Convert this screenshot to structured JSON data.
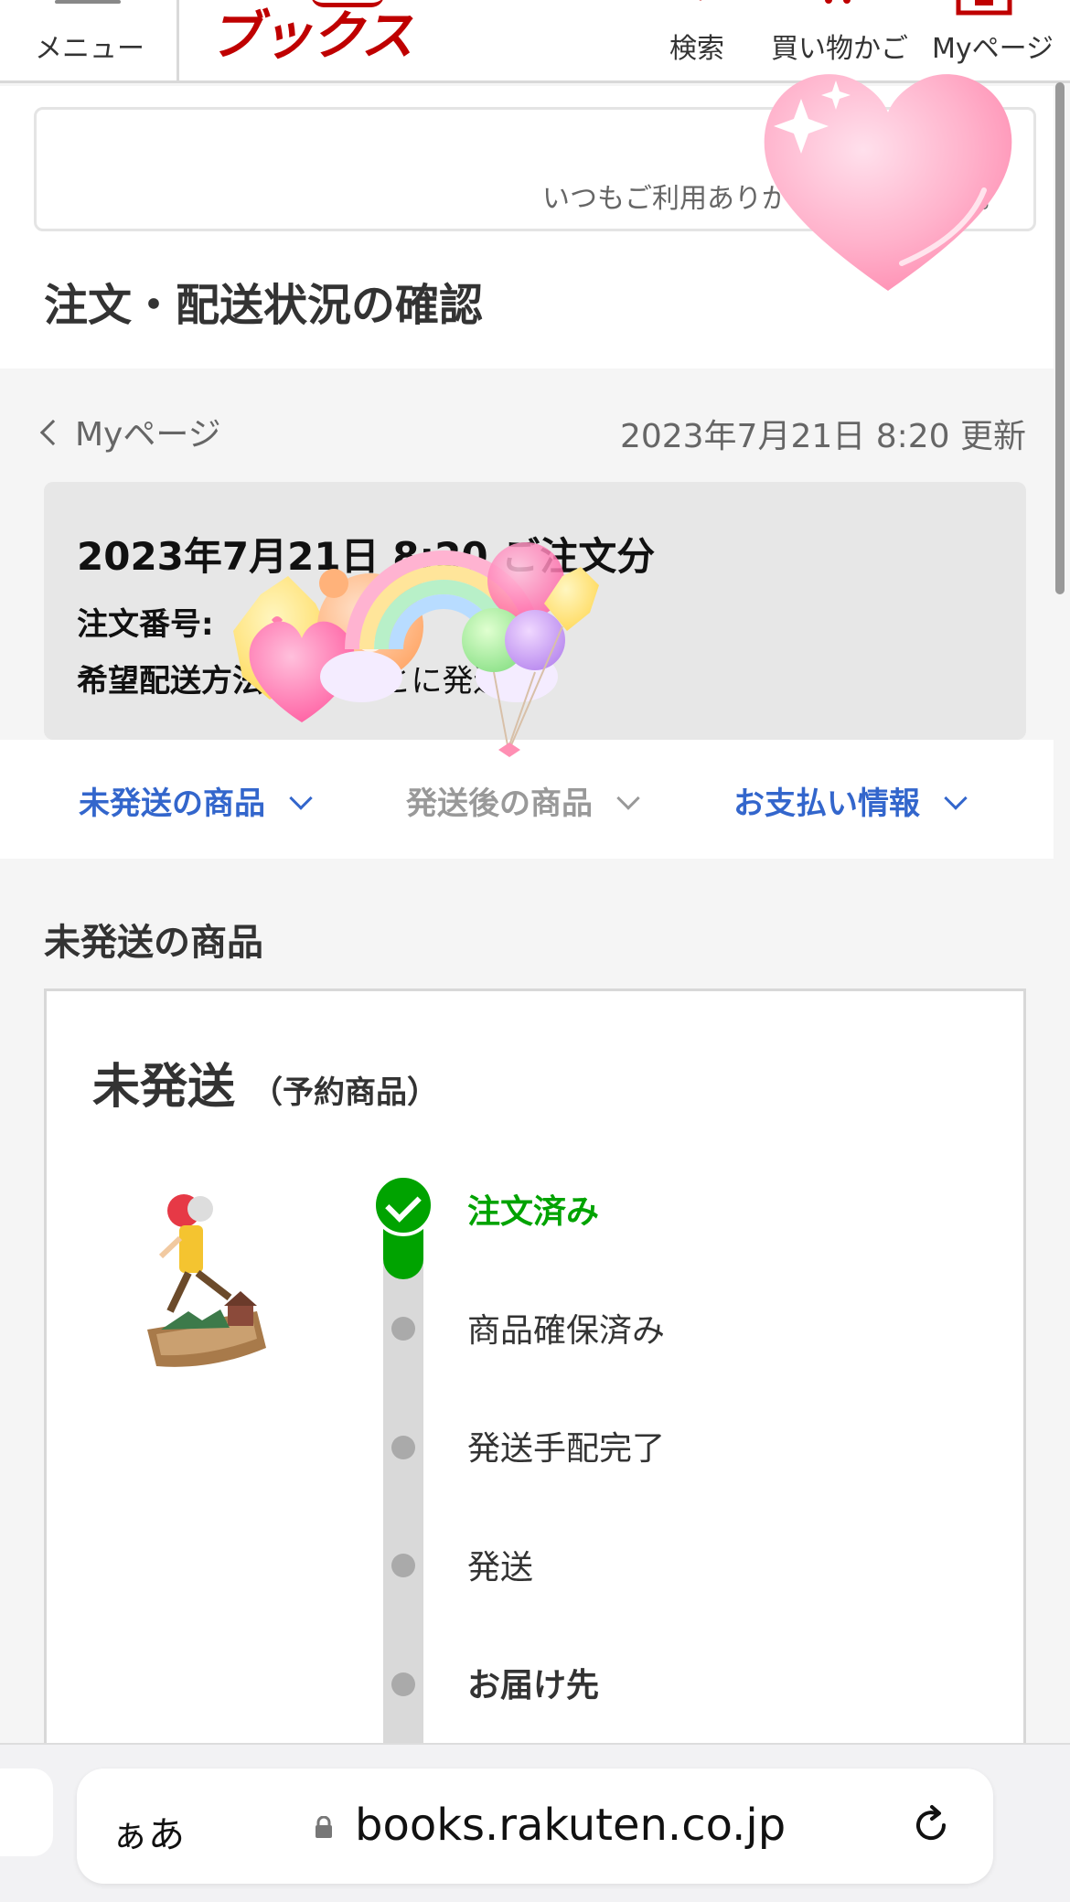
{
  "header": {
    "menu_label": "メニュー",
    "logo_text": "ブックス",
    "search_label": "検索",
    "cart_label": "買い物かご",
    "mypage_label": "Myページ"
  },
  "notice": {
    "text": "いつもご利用ありがとうございます。"
  },
  "page_title": "注文・配送状況の確認",
  "subnav": {
    "back_label": "Myページ",
    "updated_text": "2023年7月21日 8:20 更新"
  },
  "order": {
    "title": "2023年7月21日 8:20 ご注文分",
    "number_label": "注文番号:",
    "delivery_label": "希望配送方法:",
    "delivery_value": "商品ごとに発送"
  },
  "tabs": [
    {
      "label": "未発送の商品",
      "color": "#3366cc"
    },
    {
      "label": "発送後の商品",
      "color": "#999999"
    },
    {
      "label": "お支払い情報",
      "color": "#3366cc"
    }
  ],
  "section": {
    "title": "未発送の商品",
    "card_title": "未発送",
    "card_subtitle": "（予約商品）"
  },
  "steps": [
    {
      "label": "注文済み",
      "state": "done"
    },
    {
      "label": "商品確保済み",
      "state": "pending"
    },
    {
      "label": "発送手配完了",
      "state": "pending"
    },
    {
      "label": "発送",
      "state": "pending"
    },
    {
      "label": "お届け先",
      "state": "pending"
    }
  ],
  "browser": {
    "aa_label": "ぁあ",
    "url": "books.rakuten.co.jp"
  },
  "colors": {
    "brand_red": "#bf0000",
    "link_blue": "#3366cc",
    "progress_green": "#00a300"
  }
}
